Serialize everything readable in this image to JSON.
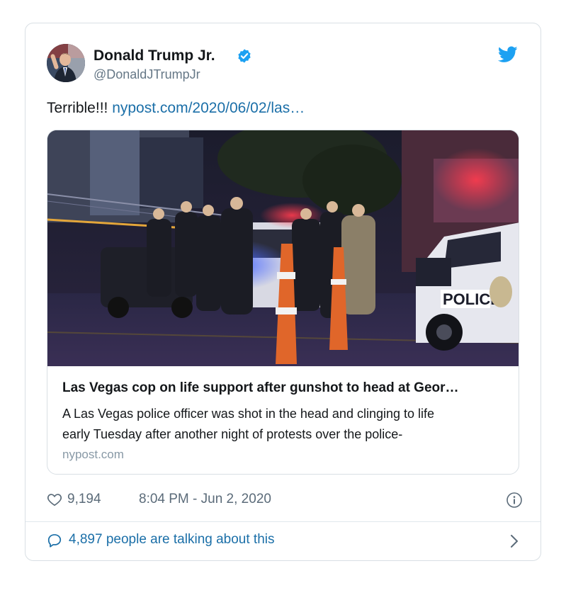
{
  "tweet": {
    "author_name": "Donald Trump Jr.",
    "author_handle": "@DonaldJTrumpJr",
    "verified": true,
    "text": "Terrible!!!",
    "link_text": "nypost.com/2020/06/02/las…",
    "likes": "9,194",
    "timestamp": "8:04 PM - Jun 2, 2020",
    "talking_text": "4,897 people are talking about this"
  },
  "link_card": {
    "title": "Las Vegas cop on life support after gunshot to head at Geor…",
    "description_lines": [
      "A Las Vegas police officer was shot in the head and clinging to life",
      "early Tuesday after another night of protests over the police-"
    ],
    "domain": "nypost.com",
    "image_caption_text": "POLICE"
  },
  "icons": {
    "verified": "verified-badge-icon",
    "brand": "twitter-bird-icon",
    "like": "heart-icon",
    "info": "info-icon",
    "reply": "speech-bubble-icon",
    "more": "chevron-right-icon"
  },
  "colors": {
    "link": "#1b6fa8",
    "twitter_blue": "#1da1f2",
    "muted": "#657786",
    "border": "#d9dfe4"
  }
}
